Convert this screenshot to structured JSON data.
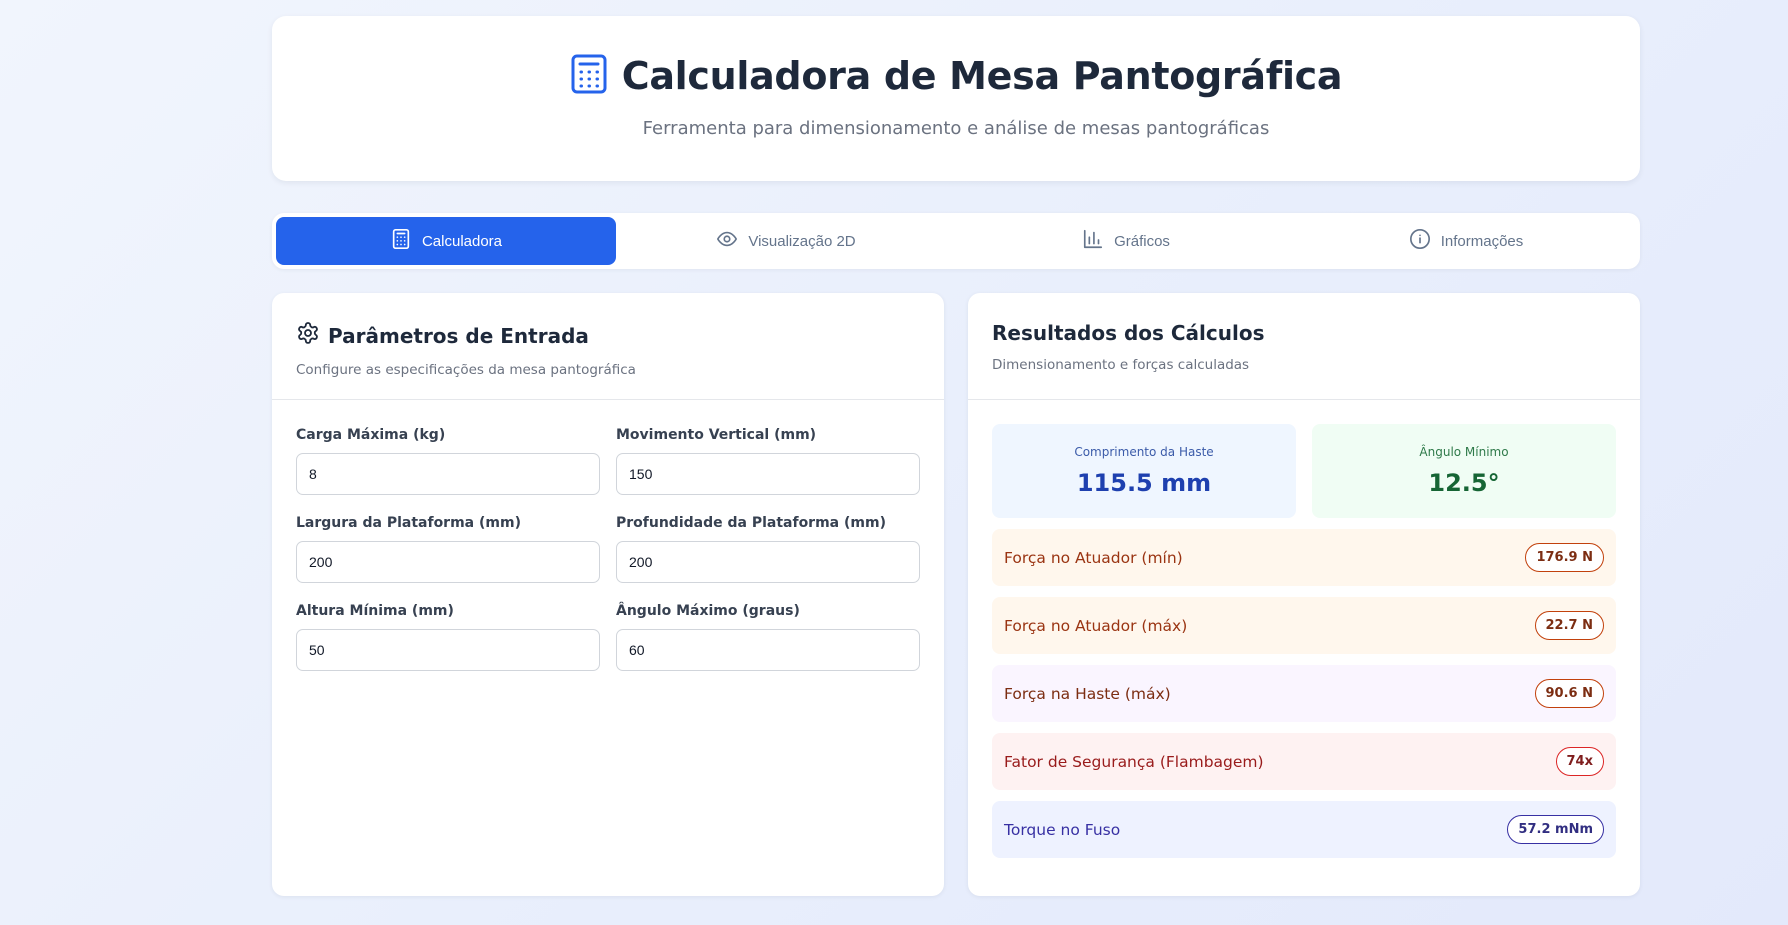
{
  "header": {
    "title": "Calculadora de Mesa Pantográfica",
    "subtitle": "Ferramenta para dimensionamento e análise de mesas pantográficas",
    "icon": "calculator-icon"
  },
  "tabs": [
    {
      "label": "Calculadora",
      "icon": "calculator-icon",
      "active": true
    },
    {
      "label": "Visualização 2D",
      "icon": "eye-icon",
      "active": false
    },
    {
      "label": "Gráficos",
      "icon": "bar-chart-icon",
      "active": false
    },
    {
      "label": "Informações",
      "icon": "info-icon",
      "active": false
    }
  ],
  "inputs": {
    "title": "Parâmetros de Entrada",
    "description": "Configure as especificações da mesa pantográfica",
    "fields": [
      {
        "label": "Carga Máxima (kg)",
        "value": "8"
      },
      {
        "label": "Movimento Vertical (mm)",
        "value": "150"
      },
      {
        "label": "Largura da Plataforma (mm)",
        "value": "200"
      },
      {
        "label": "Profundidade da Plataforma (mm)",
        "value": "200"
      },
      {
        "label": "Altura Mínima (mm)",
        "value": "50"
      },
      {
        "label": "Ângulo Máximo (graus)",
        "value": "60"
      }
    ]
  },
  "results": {
    "title": "Resultados dos Cálculos",
    "description": "Dimensionamento e forças calculadas",
    "stats": [
      {
        "label": "Comprimento da Haste",
        "value": "115.5 mm"
      },
      {
        "label": "Ângulo Mínimo",
        "value": "12.5°"
      }
    ],
    "rows": [
      {
        "label": "Força no Atuador (mín)",
        "value": "176.9 N"
      },
      {
        "label": "Força no Atuador (máx)",
        "value": "22.7 N"
      },
      {
        "label": "Força na Haste (máx)",
        "value": "90.6 N"
      },
      {
        "label": "Fator de Segurança (Flambagem)",
        "value": "74x"
      },
      {
        "label": "Torque no Fuso",
        "value": "57.2 mNm"
      }
    ]
  },
  "colors": {
    "accent": "#2563eb",
    "background": "#eef2fc"
  }
}
